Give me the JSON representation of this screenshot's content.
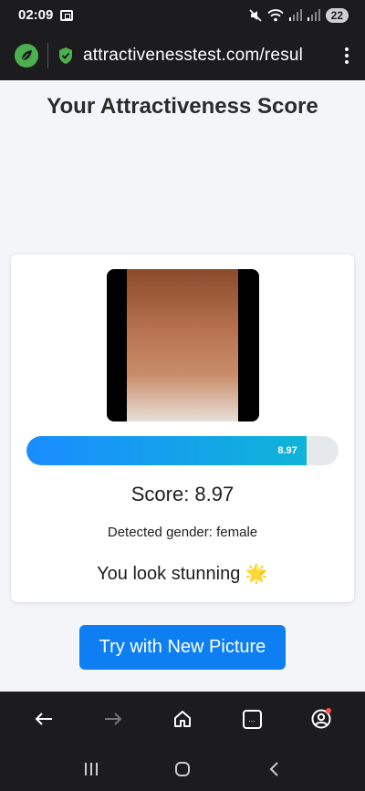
{
  "status_bar": {
    "time": "02:09",
    "battery": "22",
    "icons": [
      "screenshot-icon",
      "mute-icon",
      "wifi-icon",
      "signal-icon",
      "signal-icon"
    ]
  },
  "browser": {
    "url": "attractivenesstest.com/resul",
    "icons": [
      "leaf-icon",
      "shield-check-icon",
      "more-vert-icon"
    ]
  },
  "page": {
    "title": "Your Attractiveness Score",
    "score_progress": 0.897,
    "progress_label": "8.97",
    "score_text": "Score: 8.97",
    "gender_text": "Detected gender: female",
    "verdict_text": "You look stunning 🌟",
    "try_button": "Try with New Picture"
  },
  "toolbar": {
    "icons": [
      "back-icon",
      "forward-icon",
      "home-icon",
      "tabs-icon",
      "account-icon"
    ],
    "tabs_glyph": "..."
  },
  "nav_bar": {
    "icons": [
      "recents-icon",
      "home-circle-icon",
      "back-chevron-icon"
    ]
  },
  "colors": {
    "accent": "#0d7ff2",
    "progress_start": "#1a8cff",
    "progress_end": "#0fb4d8",
    "bar_bg": "#1c1c1e",
    "leaf_green": "#4caf50",
    "notification_dot": "#ff4b4b"
  }
}
